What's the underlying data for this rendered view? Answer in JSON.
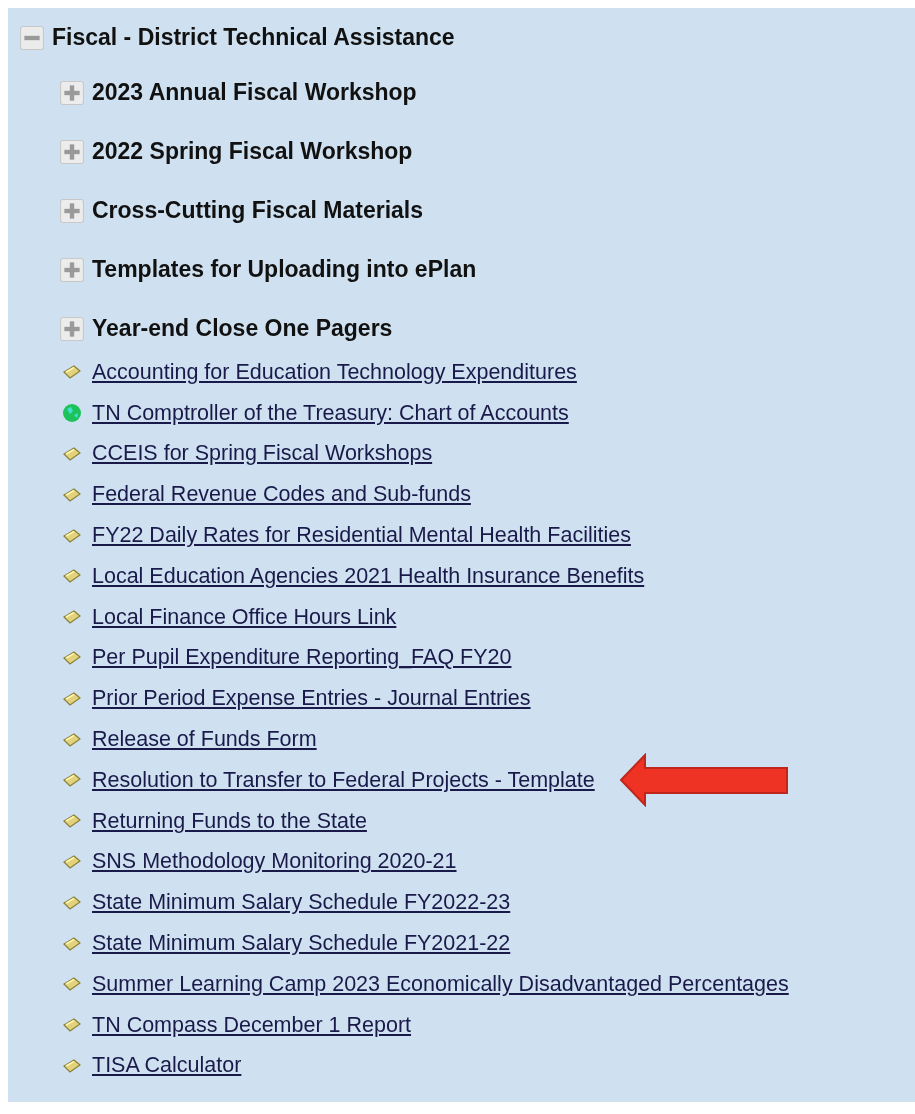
{
  "tree": {
    "label": "Fiscal - District Technical Assistance",
    "expanded": true,
    "folders": [
      {
        "label": "2023 Annual Fiscal Workshop",
        "expanded": false
      },
      {
        "label": "2022 Spring Fiscal Workshop",
        "expanded": false
      },
      {
        "label": "Cross-Cutting Fiscal Materials",
        "expanded": false
      },
      {
        "label": "Templates for Uploading into ePlan",
        "expanded": false
      },
      {
        "label": "Year-end Close One Pagers",
        "expanded": false
      }
    ],
    "links": [
      {
        "label": "Accounting for Education Technology Expenditures",
        "kind": "document",
        "pointed": false
      },
      {
        "label": "TN Comptroller of the Treasury: Chart of Accounts",
        "kind": "web",
        "pointed": false
      },
      {
        "label": "CCEIS for Spring Fiscal Workshops",
        "kind": "document",
        "pointed": false
      },
      {
        "label": "Federal Revenue Codes and Sub-funds",
        "kind": "document",
        "pointed": false
      },
      {
        "label": "FY22 Daily Rates for Residential Mental Health Facilities",
        "kind": "document",
        "pointed": false
      },
      {
        "label": "Local Education Agencies 2021 Health Insurance Benefits",
        "kind": "document",
        "pointed": false
      },
      {
        "label": "Local Finance Office Hours Link",
        "kind": "document",
        "pointed": false
      },
      {
        "label": "Per Pupil Expenditure Reporting_FAQ FY20",
        "kind": "document",
        "pointed": false
      },
      {
        "label": "Prior Period Expense Entries - Journal Entries",
        "kind": "document",
        "pointed": false
      },
      {
        "label": "Release of Funds Form",
        "kind": "document",
        "pointed": false
      },
      {
        "label": "Resolution to Transfer to Federal Projects - Template",
        "kind": "document",
        "pointed": true
      },
      {
        "label": "Returning Funds to the State",
        "kind": "document",
        "pointed": false
      },
      {
        "label": "SNS Methodology Monitoring 2020-21",
        "kind": "document",
        "pointed": false
      },
      {
        "label": "State Minimum Salary Schedule FY2022-23",
        "kind": "document",
        "pointed": false
      },
      {
        "label": "State Minimum Salary Schedule FY2021-22",
        "kind": "document",
        "pointed": false
      },
      {
        "label": "Summer Learning Camp 2023 Economically Disadvantaged Percentages",
        "kind": "document",
        "pointed": false
      },
      {
        "label": "TN Compass December 1 Report",
        "kind": "document",
        "pointed": false
      },
      {
        "label": "TISA Calculator",
        "kind": "document",
        "pointed": false
      }
    ]
  }
}
